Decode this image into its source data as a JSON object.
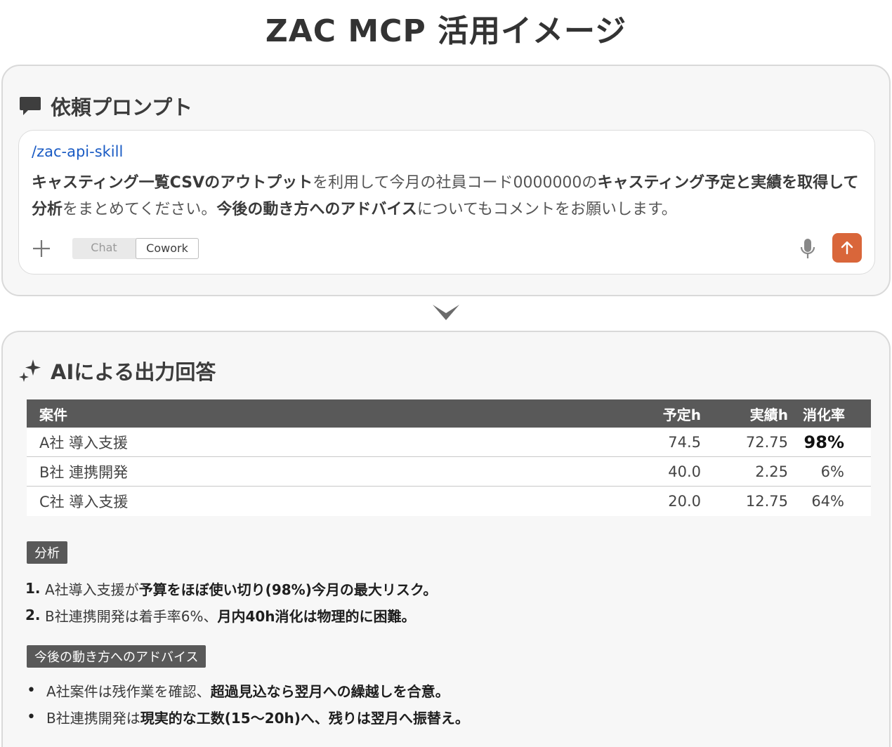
{
  "page_title": "ZAC MCP 活用イメージ",
  "prompt_section": {
    "heading": "依頼プロンプト",
    "icon": "chat-bubble-icon",
    "command": "/zac-api-skill",
    "text_parts": [
      {
        "t": "キャスティング一覧CSVのアウトプット",
        "b": true
      },
      {
        "t": "を利用して今月の社員コード0000000の",
        "b": false
      },
      {
        "t": "キャスティング予定と実績を取得して分析",
        "b": true
      },
      {
        "t": "をまとめてください。",
        "b": false
      },
      {
        "t": "今後の動き方へのアドバイス",
        "b": true
      },
      {
        "t": "についてもコメントをお願いします。",
        "b": false
      }
    ],
    "modes": [
      "Chat",
      "Cowork"
    ],
    "active_mode": "Cowork",
    "send_color": "#d9663a"
  },
  "answer_section": {
    "heading": "AIによる出力回答",
    "icon": "sparkle-icon",
    "table": {
      "headers": [
        "案件",
        "予定h",
        "実績h",
        "消化率"
      ],
      "rows": [
        [
          "A社 導入支援",
          "74.5",
          "72.75",
          "98%"
        ],
        [
          "B社 連携開発",
          "40.0",
          "2.25",
          "6%"
        ],
        [
          "C社 導入支援",
          "20.0",
          "12.75",
          "64%"
        ]
      ]
    },
    "analysis": {
      "tag": "分析",
      "items": [
        {
          "marker": "1.",
          "parts": [
            {
              "t": "A社導入支援が",
              "b": false
            },
            {
              "t": "予算をほぼ使い切り(98%)今月の最大リスク。",
              "b": true
            }
          ]
        },
        {
          "marker": "2.",
          "parts": [
            {
              "t": "B社連携開発は着手率6%、",
              "b": false
            },
            {
              "t": "月内40h消化は物理的に困難。",
              "b": true
            }
          ]
        }
      ]
    },
    "advice": {
      "tag": "今後の動き方へのアドバイス",
      "items": [
        {
          "marker": "•",
          "parts": [
            {
              "t": "A社案件は残作業を確認、",
              "b": false
            },
            {
              "t": "超過見込なら翌月への繰越しを合意。",
              "b": true
            }
          ]
        },
        {
          "marker": "•",
          "parts": [
            {
              "t": "B社連携開発は",
              "b": false
            },
            {
              "t": "現実的な工数(15〜20h)へ、残りは翌月へ振替え。",
              "b": true
            }
          ]
        }
      ]
    }
  }
}
